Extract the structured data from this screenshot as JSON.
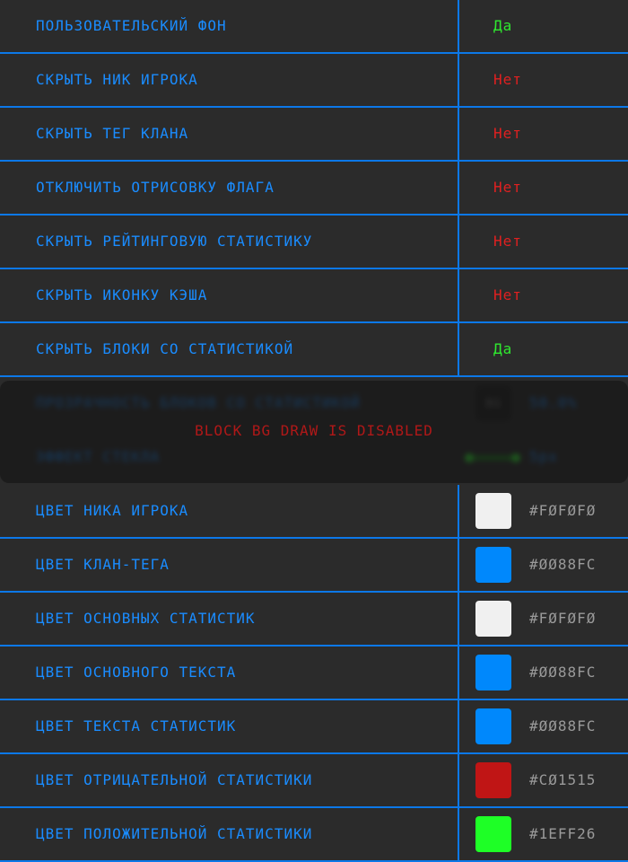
{
  "settings": [
    {
      "label": "Пользовательский фон",
      "value": "Да",
      "state": "yes"
    },
    {
      "label": "Скрыть ник игрока",
      "value": "Нет",
      "state": "no"
    },
    {
      "label": "Скрыть тег клана",
      "value": "Нет",
      "state": "no"
    },
    {
      "label": "Отключить отрисовку флага",
      "value": "Нет",
      "state": "no"
    },
    {
      "label": "Скрыть рейтинговую статистику",
      "value": "Нет",
      "state": "no"
    },
    {
      "label": "Скрыть иконку кэша",
      "value": "Нет",
      "state": "no"
    },
    {
      "label": "Скрыть блоки со статистикой",
      "value": "Да",
      "state": "yes"
    }
  ],
  "disabled_block": {
    "message": "BLOCK BG DRAW IS DISABLED",
    "rows": [
      {
        "label": "ПРОЗРАЧНОСТЬ БЛОКОВ СО СТАТИСТИКОЙ",
        "chip": "BG",
        "value": "50.0%"
      },
      {
        "label": "ЭФФЕКТ СТЕКЛА",
        "value": "5px"
      }
    ]
  },
  "colors": [
    {
      "label": "Цвет ника игрока",
      "hex": "#F0F0F0",
      "display": "#FØFØFØ"
    },
    {
      "label": "Цвет клан-тега",
      "hex": "#0088FC",
      "display": "#ØØ88FC"
    },
    {
      "label": "Цвет основных статистик",
      "hex": "#F0F0F0",
      "display": "#FØFØFØ"
    },
    {
      "label": "Цвет основного текста",
      "hex": "#0088FC",
      "display": "#ØØ88FC"
    },
    {
      "label": "Цвет текста статистик",
      "hex": "#0088FC",
      "display": "#ØØ88FC"
    },
    {
      "label": "Цвет отрицательной статистики",
      "hex": "#C01515",
      "display": "#CØ1515"
    },
    {
      "label": "Цвет положительной статистики",
      "hex": "#1EFF26",
      "display": "#1EFF26"
    }
  ]
}
